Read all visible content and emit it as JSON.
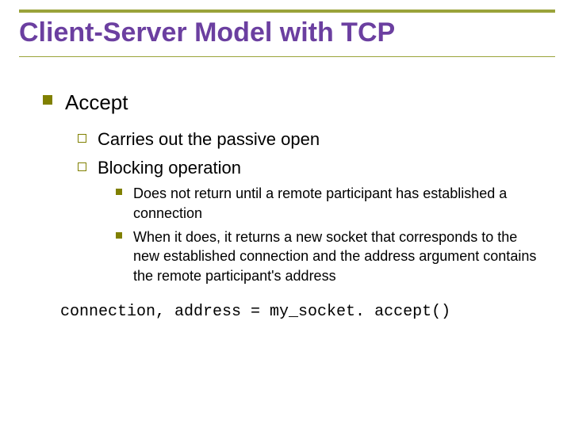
{
  "title": "Client-Server Model with TCP",
  "l1_0": "Accept",
  "l2_0": "Carries out the passive open",
  "l2_1": "Blocking operation",
  "l3_0": "Does not return until a remote participant has established a connection",
  "l3_1": "When it does, it returns a new socket that corresponds to the new established connection and the address argument contains the remote participant's address",
  "code": "connection, address = my_socket. accept()"
}
